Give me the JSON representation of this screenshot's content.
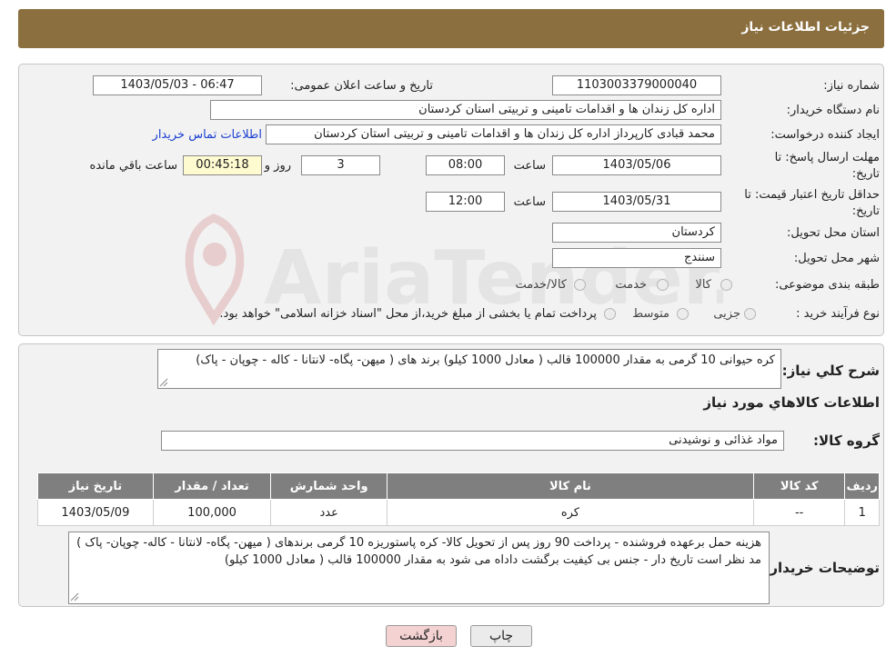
{
  "header": {
    "title": "جزئیات اطلاعات نیاز"
  },
  "form": {
    "need_number_label": "شماره نیاز:",
    "need_number": "1103003379000040",
    "announce_label": "تاریخ و ساعت اعلان عمومی:",
    "announce_value": "1403/05/03 - 06:47",
    "buyer_org_label": "نام دستگاه خریدار:",
    "buyer_org": "اداره کل زندان ها و اقدامات تامینی و تربیتی استان کردستان",
    "creator_label": "ایجاد کننده درخواست:",
    "creator": "محمد  قبادی کارپرداز اداره کل زندان ها و اقدامات تامینی و تربیتی استان کردستان",
    "contact_link": "اطلاعات تماس خریدار",
    "deadline_label": "مهلت ارسال پاسخ: تا تاریخ:",
    "deadline_date": "1403/05/06",
    "time_label": "ساعت",
    "deadline_time": "08:00",
    "days_value": "3",
    "days_label": "روز و",
    "remaining_value": "00:45:18",
    "remaining_label": "ساعت باقي مانده",
    "validity_label": "حداقل تاریخ اعتبار قیمت: تا تاریخ:",
    "validity_date": "1403/05/31",
    "validity_time": "12:00",
    "province_label": "استان محل تحویل:",
    "province": "کردستان",
    "city_label": "شهر محل تحویل:",
    "city": "سنندج",
    "category_label": "طبقه بندی موضوعی:",
    "category_options": [
      "کالا",
      "خدمت",
      "کالا/خدمت"
    ],
    "purchase_type_label": "نوع فرآیند خرید :",
    "purchase_options": [
      "جزیی",
      "متوسط"
    ],
    "purchase_note": "پرداخت تمام یا بخشی از مبلغ خرید،از محل \"اسناد خزانه اسلامی\" خواهد بود."
  },
  "summary": {
    "general_desc_label": "شرح کلي نياز:",
    "general_desc": "کره  حیوانی 10 گرمی  به  مقدار 100000 قالب  ( معادل  1000 کیلو)  برند های (  میهن- پگاه-  لانتانا - کاله  - چوپان - پاک)",
    "goods_info_title": "اطلاعات کالاهاي مورد نياز",
    "goods_group_label": "گروه کالا:",
    "goods_group": "مواد غذائی و نوشیدنی",
    "table": {
      "headers": [
        "ردیف",
        "کد کالا",
        "نام کالا",
        "واحد شمارش",
        "تعداد / مقدار",
        "تاریخ نیاز"
      ],
      "rows": [
        [
          "1",
          "--",
          "کره",
          "عدد",
          "100,000",
          "1403/05/09"
        ]
      ]
    },
    "buyer_notes_label": "توضیحات خریدار:",
    "buyer_notes": "هزینه حمل برعهده فروشنده - پرداخت 90 روز پس از تحویل کالا-  کره  پاستوریزه 10 گرمی برندهای ( میهن- پگاه- لانتانا - کاله- چوپان- پاک  )  مد نظر است  تاریخ دار  - جنس بی کیفیت برگشت داداه می شود به  مقدار 100000 قالب  ( معادل  1000 کیلو)"
  },
  "buttons": {
    "print": "چاپ",
    "back": "بازگشت"
  },
  "watermark": "AriaTender.neT",
  "colors": {
    "header_bg": "#8b6f3e",
    "link": "#1a3fd1",
    "back_btn_bg": "#f4d2d2",
    "print_btn_bg": "#ebebeb"
  }
}
